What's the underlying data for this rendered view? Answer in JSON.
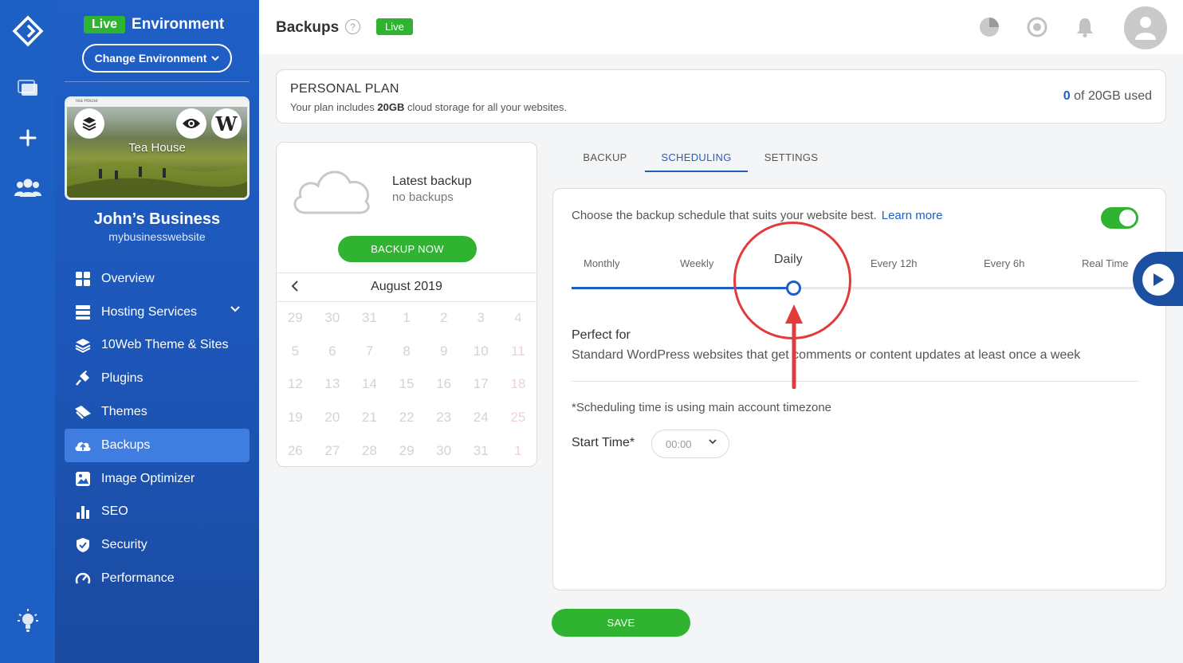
{
  "environment": {
    "badge": "Live",
    "label": "Environment",
    "change_label": "Change Environment"
  },
  "site": {
    "thumb_title": "Tea House",
    "thumb_bar": "Tea House",
    "name": "John’s Business",
    "url": "mybusinesswebsite"
  },
  "nav": [
    {
      "label": "Overview",
      "icon": "grid-icon"
    },
    {
      "label": "Hosting Services",
      "icon": "server-icon"
    },
    {
      "label": "10Web Theme & Sites",
      "icon": "layers-icon"
    },
    {
      "label": "Plugins",
      "icon": "plug-icon"
    },
    {
      "label": "Themes",
      "icon": "brush-icon"
    },
    {
      "label": "Backups",
      "icon": "cloud-upload-icon"
    },
    {
      "label": "Image Optimizer",
      "icon": "image-icon"
    },
    {
      "label": "SEO",
      "icon": "bar-chart-icon"
    },
    {
      "label": "Security",
      "icon": "shield-icon"
    },
    {
      "label": "Performance",
      "icon": "gauge-icon"
    }
  ],
  "topbar": {
    "title": "Backups",
    "help": "?",
    "badge": "Live"
  },
  "plan": {
    "title": "PERSONAL PLAN",
    "desc_pre": "Your plan includes ",
    "desc_bold": "20GB",
    "desc_post": " cloud storage for all your websites.",
    "used_num": "0",
    "used_rest": " of 20GB used"
  },
  "latest": {
    "heading": "Latest backup",
    "sub": "no backups",
    "button": "BACKUP NOW",
    "month": "August 2019",
    "days": [
      "29",
      "30",
      "31",
      "1",
      "2",
      "3",
      "4",
      "5",
      "6",
      "7",
      "8",
      "9",
      "10",
      "11",
      "12",
      "13",
      "14",
      "15",
      "16",
      "17",
      "18",
      "19",
      "20",
      "21",
      "22",
      "23",
      "24",
      "25",
      "26",
      "27",
      "28",
      "29",
      "30",
      "31",
      "1"
    ]
  },
  "tabs": [
    "BACKUP",
    "SCHEDULING",
    "SETTINGS"
  ],
  "schedule": {
    "intro": "Choose the backup schedule that suits your website best.",
    "learn_more": "Learn more",
    "enabled": true,
    "frequencies": [
      "Monthly",
      "Weekly",
      "Daily",
      "Every 12h",
      "Every 6h",
      "Real Time"
    ],
    "selected_index": 2,
    "perfect_for": "Perfect for",
    "perfect_desc": "Standard WordPress websites that get comments or content updates at least once a week",
    "timezone_note": "*Scheduling time is using main account timezone",
    "start_time_label": "Start Time*",
    "start_time_value": "00:00"
  },
  "save_label": "SAVE",
  "colors": {
    "primary": "#1e5fc4",
    "green": "#2fb330",
    "callout": "#e23b3b"
  }
}
